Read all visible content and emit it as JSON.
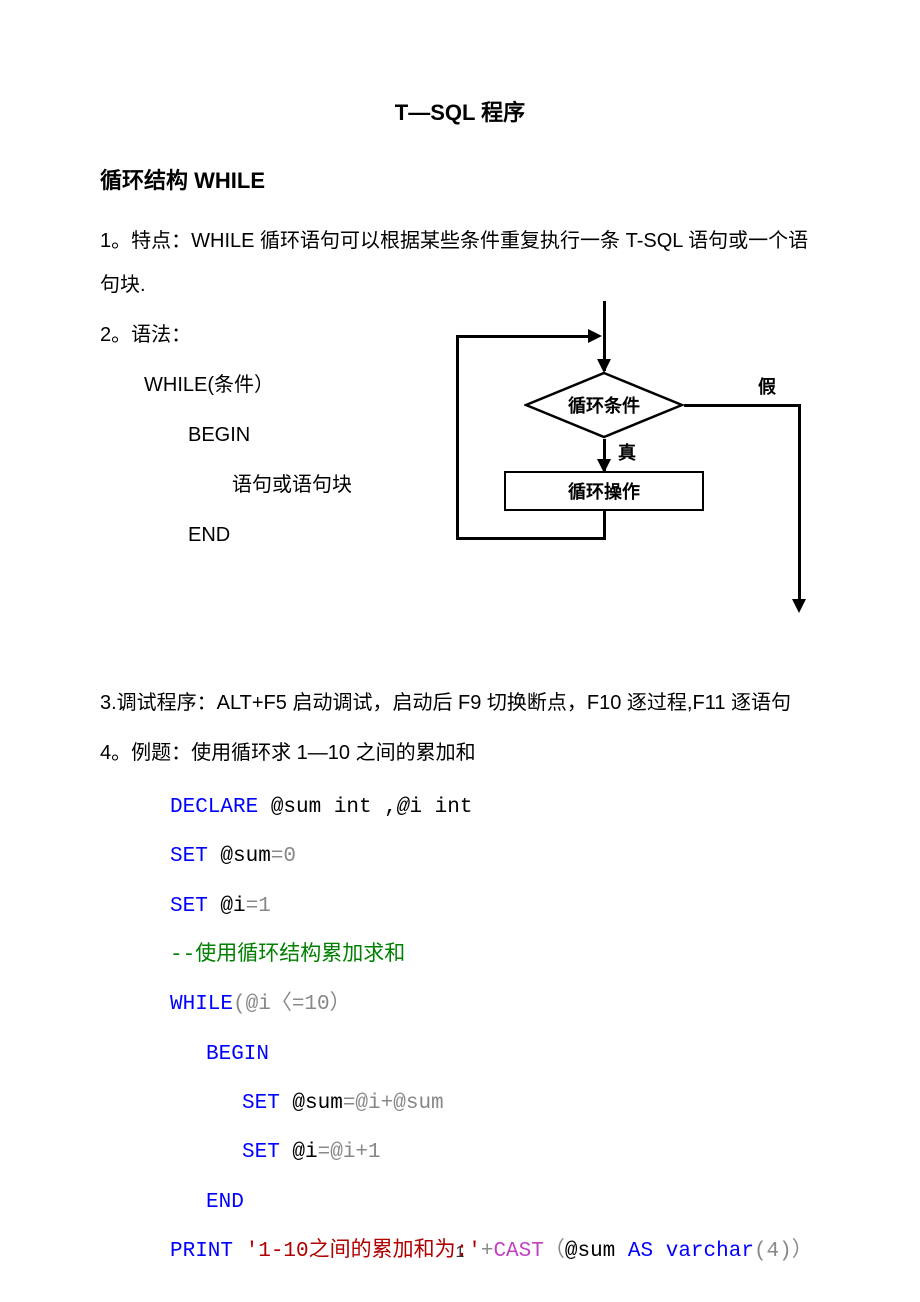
{
  "title": "T—SQL 程序",
  "section_heading": "循环结构  WHILE",
  "p1": "1。特点：WHILE 循环语句可以根据某些条件重复执行一条 T-SQL 语句或一个语句块.",
  "p2": "2。语法：",
  "syntax": {
    "l1": "WHILE(条件）",
    "l2": "BEGIN",
    "l3": "语句或语句块",
    "l4": "END"
  },
  "diagram": {
    "condition": "循环条件",
    "body": "循环操作",
    "true_label": "真",
    "false_label": "假"
  },
  "p3": "3.调试程序：ALT+F5   启动调试，启动后 F9 切换断点，F10 逐过程,F11 逐语句",
  "p4": "4。例题：使用循环求 1—10 之间的累加和",
  "code": {
    "l1_declare": "DECLARE",
    "l1_rest": " @sum int ,",
    "l1_at": "@",
    "l1_i": "i int",
    "l2_set": "SET",
    "l2_rest": " @sum",
    "l2_eq0": "=0",
    "l3_set": "SET",
    "l3_rest": " @i",
    "l3_eq1": "=1",
    "l4": "--使用循环结构累加求和",
    "l5_while": "WHILE",
    "l5_cond": "(@i〈=10）",
    "l6": "BEGIN",
    "l7_set": "SET",
    "l7_rest": " @sum",
    "l7_expr": "=@i+@sum",
    "l8_set": "SET",
    "l8_rest": " @i",
    "l8_expr": "=@i+1",
    "l9": "END",
    "l10_print": "PRINT",
    "l10_str": " '1-10之间的累加和为:'",
    "l10_plus": "+",
    "l10_cast": "CAST",
    "l10_open": "（",
    "l10_var": "@sum ",
    "l10_as": "AS",
    "l10_vc": " varchar",
    "l10_n": "(4)",
    "l10_close": "）"
  },
  "page_number": "1"
}
